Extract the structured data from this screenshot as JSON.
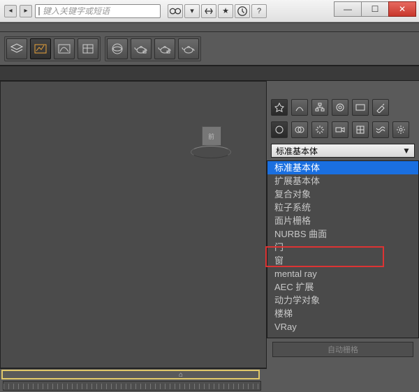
{
  "titlebar": {
    "search_placeholder": "键入关键字或短语",
    "window_min": "—",
    "window_max": "☐",
    "window_close": "✕"
  },
  "viewcube": {
    "face": "前"
  },
  "dropdown": {
    "selected": "标准基本体",
    "items": [
      "标准基本体",
      "扩展基本体",
      "复合对象",
      "粒子系统",
      "面片栅格",
      "NURBS 曲面",
      "门",
      "窗",
      "mental ray",
      "AEC 扩展",
      "动力学对象",
      "楼梯",
      "VRay"
    ]
  },
  "panel_bottom_label": "自动栅格"
}
